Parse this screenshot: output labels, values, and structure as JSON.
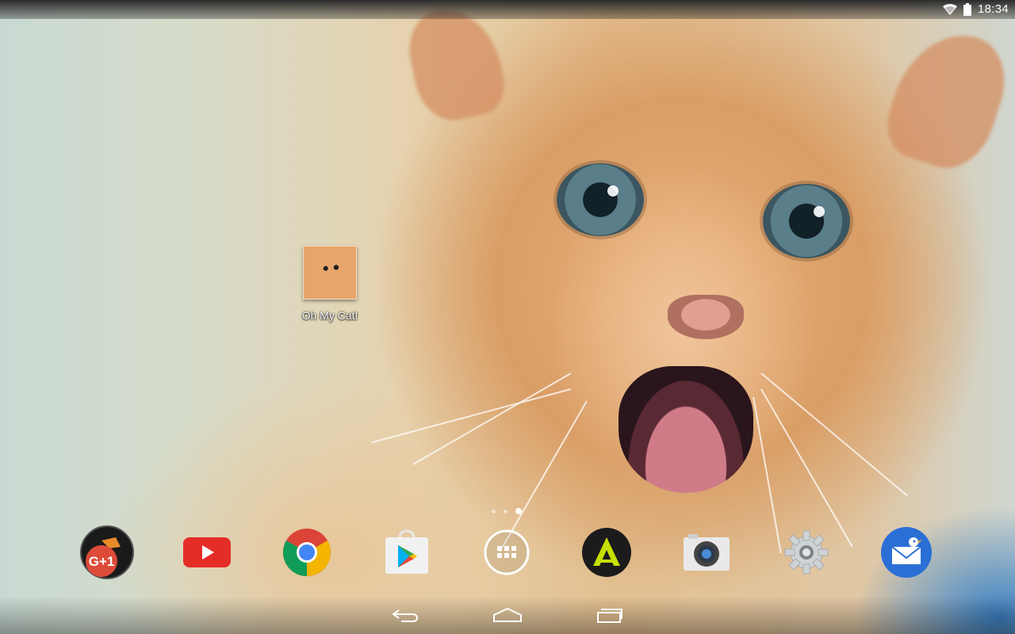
{
  "status_bar": {
    "time": "18:34",
    "icons": [
      "wifi-icon",
      "battery-icon"
    ]
  },
  "desktop": {
    "shortcut": {
      "label": "Oh My Cat!",
      "icon": "cat-photo-icon"
    },
    "page_indicator": {
      "pages": 3,
      "active_index": 2
    }
  },
  "dock": {
    "apps": [
      {
        "name": "google-plus-app",
        "icon": "google-plus-icon",
        "text": "G+1"
      },
      {
        "name": "youtube-app",
        "icon": "youtube-icon"
      },
      {
        "name": "chrome-app",
        "icon": "chrome-icon"
      },
      {
        "name": "play-store-app",
        "icon": "play-store-icon"
      },
      {
        "name": "app-drawer",
        "icon": "app-drawer-icon"
      },
      {
        "name": "aptoide-app",
        "icon": "aptoide-icon"
      },
      {
        "name": "camera-app",
        "icon": "camera-icon"
      },
      {
        "name": "settings-app",
        "icon": "settings-gear-icon"
      },
      {
        "name": "messenger-app",
        "icon": "mail-bird-icon"
      }
    ]
  },
  "nav_bar": {
    "buttons": [
      "back-icon",
      "home-icon",
      "recents-icon"
    ]
  },
  "colors": {
    "youtube_red": "#e52d27",
    "gplus_red": "#dd4b39",
    "messenger_blue": "#2a6fd6",
    "aptoide_yellow": "#c5e000"
  }
}
